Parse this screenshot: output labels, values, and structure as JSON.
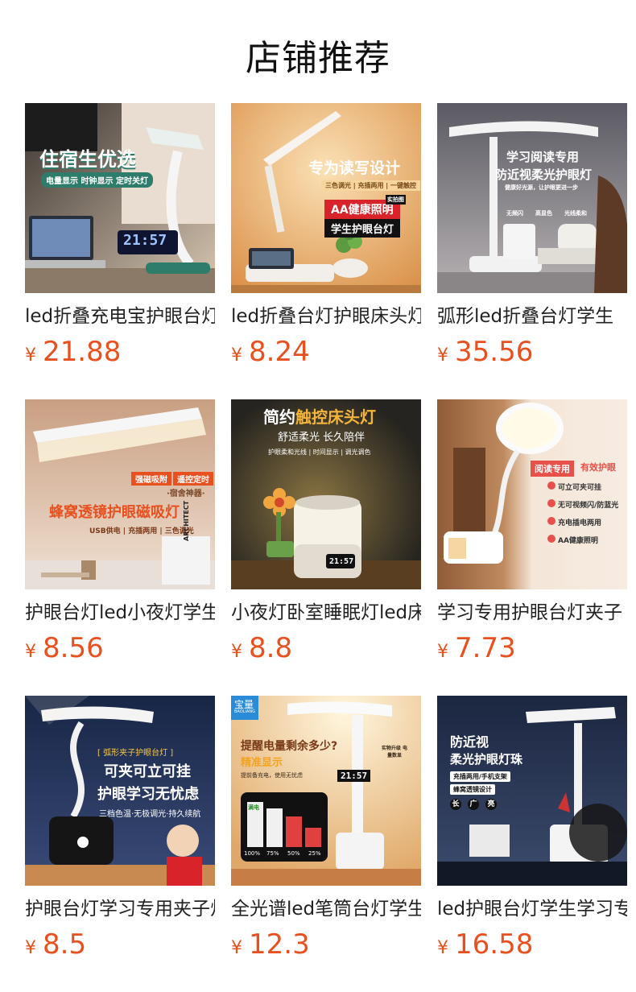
{
  "page": {
    "title": "店铺推荐"
  },
  "products": [
    {
      "name": "led折叠充电宝护眼台灯",
      "currency": "¥",
      "price": "21.88",
      "image": {
        "headline": "住宿生优选",
        "sub": "电量显示 时钟显示 定时关灯",
        "clock": "21:57",
        "colors": {
          "bg1": "#5a4a3e",
          "bg2": "#cdbfae",
          "accent": "#2e7d6b"
        }
      }
    },
    {
      "name": "led折叠台灯护眼床头灯",
      "currency": "¥",
      "price": "8.24",
      "image": {
        "headline": "专为读写设计",
        "sub": "三色调光 | 充插两用 | 一键触控",
        "badge": "AA健康照明",
        "badge2": "学生护眼台灯",
        "corner": "实拍图",
        "colors": {
          "bg1": "#f6c98a",
          "bg2": "#e6a25c",
          "accent": "#d8232a"
        }
      }
    },
    {
      "name": "弧形led折叠台灯学生",
      "currency": "¥",
      "price": "35.56",
      "image": {
        "headline": "学习阅读专用",
        "headline2": "防近视柔光护眼灯",
        "sub": "健康好光源，让护眼更进一步",
        "features": [
          "无频闪",
          "高显色",
          "光线柔和"
        ],
        "colors": {
          "bg1": "#6e6c75",
          "bg2": "#bdb8bb",
          "accent": "#ffffff"
        }
      }
    },
    {
      "name": "护眼台灯led小夜灯学生",
      "currency": "¥",
      "price": "8.56",
      "image": {
        "tags": [
          "强磁吸附",
          "遥控定时"
        ],
        "label": "·宿舍神器·",
        "headline": "蜂窝透镜护眼磁吸灯",
        "sub": "USB供电 | 充插两用 | 三色调光",
        "side": "ARCHITECT",
        "colors": {
          "bg1": "#d9b79d",
          "bg2": "#f0e0d0",
          "accent": "#e8501f"
        }
      }
    },
    {
      "name": "小夜灯卧室睡眠灯led床头灯",
      "currency": "¥",
      "price": "8.8",
      "image": {
        "headline": "简约",
        "headline_hl": "触控床头灯",
        "sub": "舒适柔光 长久陪伴",
        "sub2": "护眼柔和光线 | 时间显示 | 调光调色",
        "clock": "21:57",
        "colors": {
          "bg1": "#2b2a26",
          "bg2": "#6a5a3c",
          "accent": "#f4b43a"
        }
      }
    },
    {
      "name": "学习专用护眼台灯夹子",
      "currency": "¥",
      "price": "7.73",
      "image": {
        "tag1": "阅读专用",
        "tag2": "有效护眼",
        "items": [
          "可立可夹可挂",
          "无可视频闪/防蓝光",
          "充电插电两用",
          "AA健康照明"
        ],
        "colors": {
          "bg1": "#a16a43",
          "bg2": "#f2e2d2",
          "accent": "#e8504a"
        }
      }
    },
    {
      "name": "护眼台灯学习专用夹子灯",
      "currency": "¥",
      "price": "8.5",
      "image": {
        "tag": "[ 弧形夹子护眼台灯 ]",
        "headline": "可夹可立可挂",
        "headline2": "护眼学习无忧虑",
        "sub": "三档色温·无极调光·持久续航",
        "colors": {
          "bg1": "#1d2d52",
          "bg2": "#3a4d7a",
          "accent": "#f5c84a"
        }
      }
    },
    {
      "name": "全光谱led笔筒台灯学生",
      "currency": "¥",
      "price": "12.3",
      "image": {
        "brand": "宝量",
        "brand_en": "BAOLIANG",
        "headline": "提醒电量剩余多少?",
        "headline2": "精准显示",
        "sub": "提前备充电，使用无忧虑",
        "badge": "实物升级 电量数显",
        "clock": "21:57",
        "levels": [
          "100%",
          "75%",
          "50%",
          "25%"
        ],
        "level_label": "满电",
        "colors": {
          "bg1": "#e8b77a",
          "bg2": "#fff3e0",
          "accent": "#f2c230"
        }
      }
    },
    {
      "name": "led护眼台灯学生学习专用",
      "currency": "¥",
      "price": "16.58",
      "image": {
        "headline": "防近视",
        "headline2": "柔光护眼灯珠",
        "tag1": "充插两用/手机支架",
        "tag2": "蜂窝透镜设计",
        "icons": [
          "长",
          "广",
          "亮"
        ],
        "colors": {
          "bg1": "#1e2a44",
          "bg2": "#3b4a6b",
          "accent": "#ffffff"
        }
      }
    }
  ]
}
